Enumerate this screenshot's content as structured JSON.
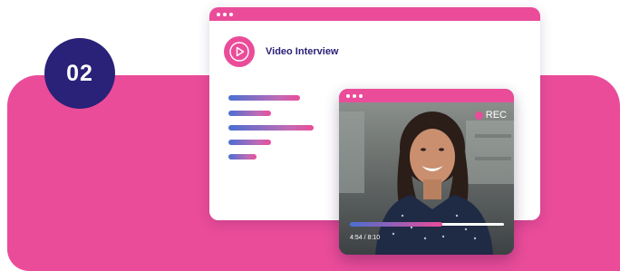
{
  "step_badge": {
    "number": "02"
  },
  "browser_card": {
    "title": "Video Interview",
    "text_lines": [
      "placeholder-line",
      "placeholder-line",
      "placeholder-line",
      "placeholder-line",
      "placeholder-line"
    ]
  },
  "video_card": {
    "rec_label": "REC",
    "timecode": "4:54 / 8:10",
    "progress": 0.6
  },
  "colors": {
    "accent_pink": "#ea4c9a",
    "navy": "#2a2178"
  },
  "icons": {
    "play": "play-icon"
  }
}
